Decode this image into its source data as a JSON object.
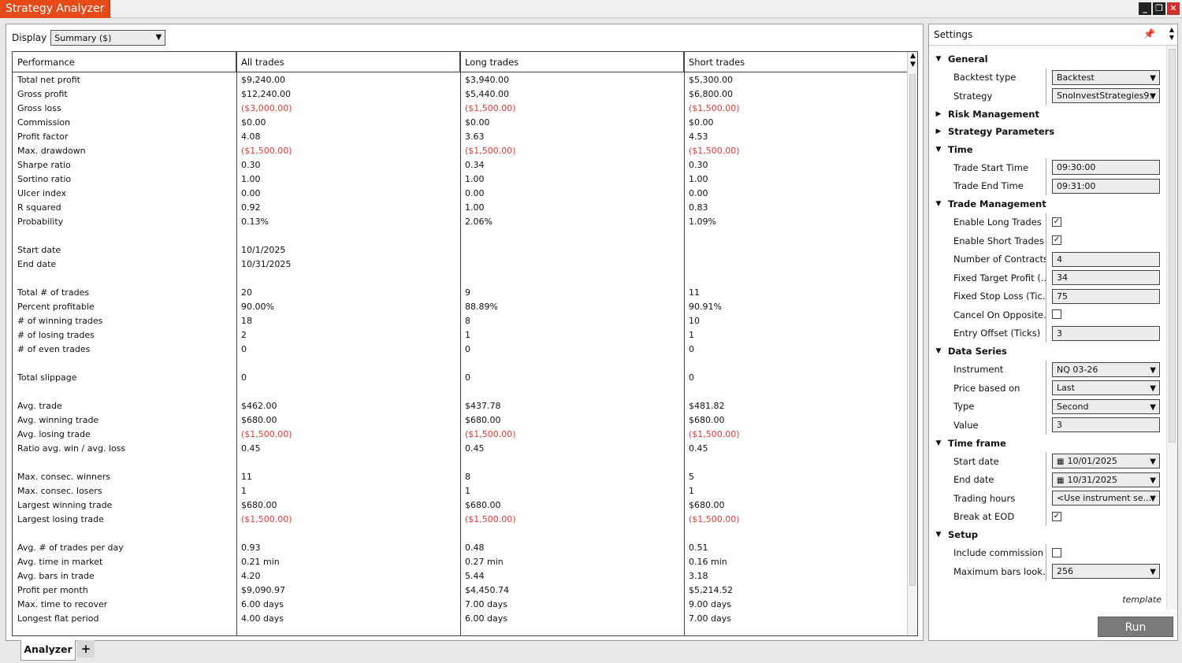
{
  "window": {
    "title": "Strategy Analyzer",
    "minimize_label": "_",
    "restore_label": "❐",
    "close_label": "✕"
  },
  "display": {
    "label": "Display",
    "value": "Summary ($)"
  },
  "table": {
    "headers": [
      "Performance",
      "All trades",
      "Long trades",
      "Short trades"
    ],
    "rows": [
      {
        "label": "Total net profit",
        "all": "$9,240.00",
        "long": "$3,940.00",
        "short": "$5,300.00"
      },
      {
        "label": "Gross profit",
        "all": "$12,240.00",
        "long": "$5,440.00",
        "short": "$6,800.00"
      },
      {
        "label": "Gross loss",
        "all": "($3,000.00)",
        "long": "($1,500.00)",
        "short": "($1,500.00)",
        "neg": true
      },
      {
        "label": "Commission",
        "all": "$0.00",
        "long": "$0.00",
        "short": "$0.00"
      },
      {
        "label": "Profit factor",
        "all": "4.08",
        "long": "3.63",
        "short": "4.53"
      },
      {
        "label": "Max. drawdown",
        "all": "($1,500.00)",
        "long": "($1,500.00)",
        "short": "($1,500.00)",
        "neg": true
      },
      {
        "label": "Sharpe ratio",
        "all": "0.30",
        "long": "0.34",
        "short": "0.30"
      },
      {
        "label": "Sortino ratio",
        "all": "1.00",
        "long": "1.00",
        "short": "1.00"
      },
      {
        "label": "Ulcer index",
        "all": "0.00",
        "long": "0.00",
        "short": "0.00"
      },
      {
        "label": "R squared",
        "all": "0.92",
        "long": "1.00",
        "short": "0.83"
      },
      {
        "label": "Probability",
        "all": "0.13%",
        "long": "2.06%",
        "short": "1.09%"
      },
      {
        "label": "",
        "all": "",
        "long": "",
        "short": ""
      },
      {
        "label": "Start date",
        "all": "10/1/2025",
        "long": "",
        "short": ""
      },
      {
        "label": "End date",
        "all": "10/31/2025",
        "long": "",
        "short": ""
      },
      {
        "label": "",
        "all": "",
        "long": "",
        "short": ""
      },
      {
        "label": "Total # of trades",
        "all": "20",
        "long": "9",
        "short": "11"
      },
      {
        "label": "Percent profitable",
        "all": "90.00%",
        "long": "88.89%",
        "short": "90.91%"
      },
      {
        "label": "# of winning trades",
        "all": "18",
        "long": "8",
        "short": "10"
      },
      {
        "label": "# of losing trades",
        "all": "2",
        "long": "1",
        "short": "1"
      },
      {
        "label": "# of even trades",
        "all": "0",
        "long": "0",
        "short": "0"
      },
      {
        "label": "",
        "all": "",
        "long": "",
        "short": ""
      },
      {
        "label": "Total slippage",
        "all": "0",
        "long": "0",
        "short": "0"
      },
      {
        "label": "",
        "all": "",
        "long": "",
        "short": ""
      },
      {
        "label": "Avg. trade",
        "all": "$462.00",
        "long": "$437.78",
        "short": "$481.82"
      },
      {
        "label": "Avg. winning trade",
        "all": "$680.00",
        "long": "$680.00",
        "short": "$680.00"
      },
      {
        "label": "Avg. losing trade",
        "all": "($1,500.00)",
        "long": "($1,500.00)",
        "short": "($1,500.00)",
        "neg": true
      },
      {
        "label": "Ratio avg. win / avg. loss",
        "all": "0.45",
        "long": "0.45",
        "short": "0.45"
      },
      {
        "label": "",
        "all": "",
        "long": "",
        "short": ""
      },
      {
        "label": "Max. consec. winners",
        "all": "11",
        "long": "8",
        "short": "5"
      },
      {
        "label": "Max. consec. losers",
        "all": "1",
        "long": "1",
        "short": "1"
      },
      {
        "label": "Largest winning trade",
        "all": "$680.00",
        "long": "$680.00",
        "short": "$680.00"
      },
      {
        "label": "Largest losing trade",
        "all": "($1,500.00)",
        "long": "($1,500.00)",
        "short": "($1,500.00)",
        "neg": true
      },
      {
        "label": "",
        "all": "",
        "long": "",
        "short": ""
      },
      {
        "label": "Avg. # of trades per day",
        "all": "0.93",
        "long": "0.48",
        "short": "0.51"
      },
      {
        "label": "Avg. time in market",
        "all": "0.21 min",
        "long": "0.27 min",
        "short": "0.16 min"
      },
      {
        "label": "Avg. bars in trade",
        "all": "4.20",
        "long": "5.44",
        "short": "3.18"
      },
      {
        "label": "Profit per month",
        "all": "$9,090.97",
        "long": "$4,450.74",
        "short": "$5,214.52"
      },
      {
        "label": "Max. time to recover",
        "all": "6.00 days",
        "long": "7.00 days",
        "short": "9.00 days"
      },
      {
        "label": "Longest flat period",
        "all": "4.00 days",
        "long": "6.00 days",
        "short": "7.00 days"
      }
    ]
  },
  "settings": {
    "title": "Settings",
    "sections": [
      {
        "name": "General",
        "expanded": true,
        "props": [
          {
            "label": "Backtest type",
            "type": "select",
            "value": "Backtest"
          },
          {
            "label": "Strategy",
            "type": "select",
            "value": "SnoInvestStrategies9:"
          }
        ]
      },
      {
        "name": "Risk Management",
        "expanded": false,
        "props": []
      },
      {
        "name": "Strategy Parameters",
        "expanded": false,
        "props": []
      },
      {
        "name": "Time",
        "expanded": true,
        "props": [
          {
            "label": "Trade Start Time",
            "type": "text",
            "value": "09:30:00"
          },
          {
            "label": "Trade End Time",
            "type": "text",
            "value": "09:31:00"
          }
        ]
      },
      {
        "name": "Trade Management",
        "expanded": true,
        "props": [
          {
            "label": "Enable Long Trades",
            "type": "check",
            "value": "✓"
          },
          {
            "label": "Enable Short Trades",
            "type": "check",
            "value": "✓"
          },
          {
            "label": "Number of Contracts",
            "type": "text",
            "value": "4"
          },
          {
            "label": "Fixed Target Profit (...",
            "type": "text",
            "value": "34"
          },
          {
            "label": "Fixed Stop Loss (Tic...",
            "type": "text",
            "value": "75"
          },
          {
            "label": "Cancel On Opposite...",
            "type": "check",
            "value": ""
          },
          {
            "label": "Entry Offset (Ticks)",
            "type": "text",
            "value": "3"
          }
        ]
      },
      {
        "name": "Data Series",
        "expanded": true,
        "props": [
          {
            "label": "Instrument",
            "type": "select",
            "value": "NQ 03-26"
          },
          {
            "label": "Price based on",
            "type": "select",
            "value": "Last"
          },
          {
            "label": "Type",
            "type": "select",
            "value": "Second"
          },
          {
            "label": "Value",
            "type": "text",
            "value": "3"
          }
        ]
      },
      {
        "name": "Time frame",
        "expanded": true,
        "props": [
          {
            "label": "Start date",
            "type": "date",
            "value": "10/01/2025"
          },
          {
            "label": "End date",
            "type": "date",
            "value": "10/31/2025"
          },
          {
            "label": "Trading hours",
            "type": "select",
            "value": "<Use instrument se..."
          },
          {
            "label": "Break at EOD",
            "type": "check",
            "value": "✓"
          }
        ]
      },
      {
        "name": "Setup",
        "expanded": true,
        "props": [
          {
            "label": "Include commission",
            "type": "check",
            "value": ""
          },
          {
            "label": "Maximum bars look...",
            "type": "select",
            "value": "256"
          }
        ]
      }
    ],
    "template_label": "template",
    "run_label": "Run"
  },
  "tabs": {
    "analyzer": "Analyzer",
    "add": "+"
  },
  "colors": {
    "accent": "#e64a19",
    "negative": "#e53935",
    "run_button": "#7a7a7a"
  }
}
